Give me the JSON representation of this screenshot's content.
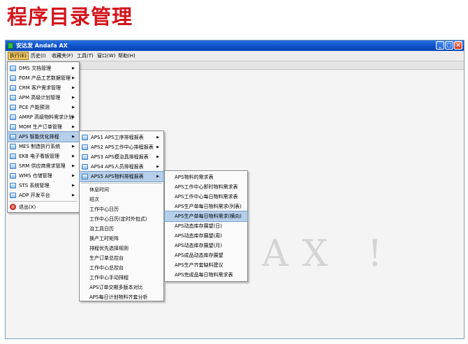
{
  "page_heading": "程序目录管理",
  "window": {
    "title": "安达发 Andafa AX",
    "buttons": {
      "minimize": "_",
      "maximize": "□",
      "close": "×"
    }
  },
  "menubar": [
    "执行(E)",
    "历史(I)",
    "收藏夹(F)",
    "工具(T)",
    "窗口(W)",
    "帮助(H)"
  ],
  "watermark": "AX !",
  "menu_level1": [
    "DMS 文档管理",
    "PDM 产品工艺数据管理",
    "CRM 客户需求管理",
    "APM 高级计划管理",
    "PCE 产能预测",
    "AMRP 高级物料需求计划",
    "MOM 生产订单管理",
    "APS 智能优化排程",
    "MES 制造执行系统",
    "EKB 电子看板管理",
    "SRM 供应商需求管理",
    "WMS 仓储管理",
    "STS 系统管理",
    "ADP 开发平台"
  ],
  "menu_exit": "退出(X)",
  "menu_level2": [
    "APS1 APS工序排程报表",
    "APS2 APS工作中心排程报表",
    "APS3 APS模治具排程报表",
    "APS4 APS人员排程报表",
    "APS5 APS物料排程报表"
  ],
  "menu_level2_plain": [
    "休息时间",
    "班次",
    "工作中心日历",
    "工作中心日历(定时外包式)",
    "治工具日历",
    "换产工时矩阵",
    "排程优先选择规则",
    "生产订单总控台",
    "工作中心总控台",
    "工作中心手动排程",
    "APS订单交期多版本对比",
    "APS每日计划物料齐套分析"
  ],
  "menu_level3": [
    "APS物料的需求表",
    "APS工作中心即时物料需求表",
    "APS工作中心每日物料需求表",
    "APS生产单每日物料需求(列表)",
    "APS生产单每日物料需求(横向)",
    "APS动态库存展望(日)",
    "APS动态库存展望(周)",
    "APS动态库存展望(月)",
    "APS成品动态库存展望",
    "APS生产齐套缺料建议",
    "APS完成品每日物料需求表"
  ]
}
